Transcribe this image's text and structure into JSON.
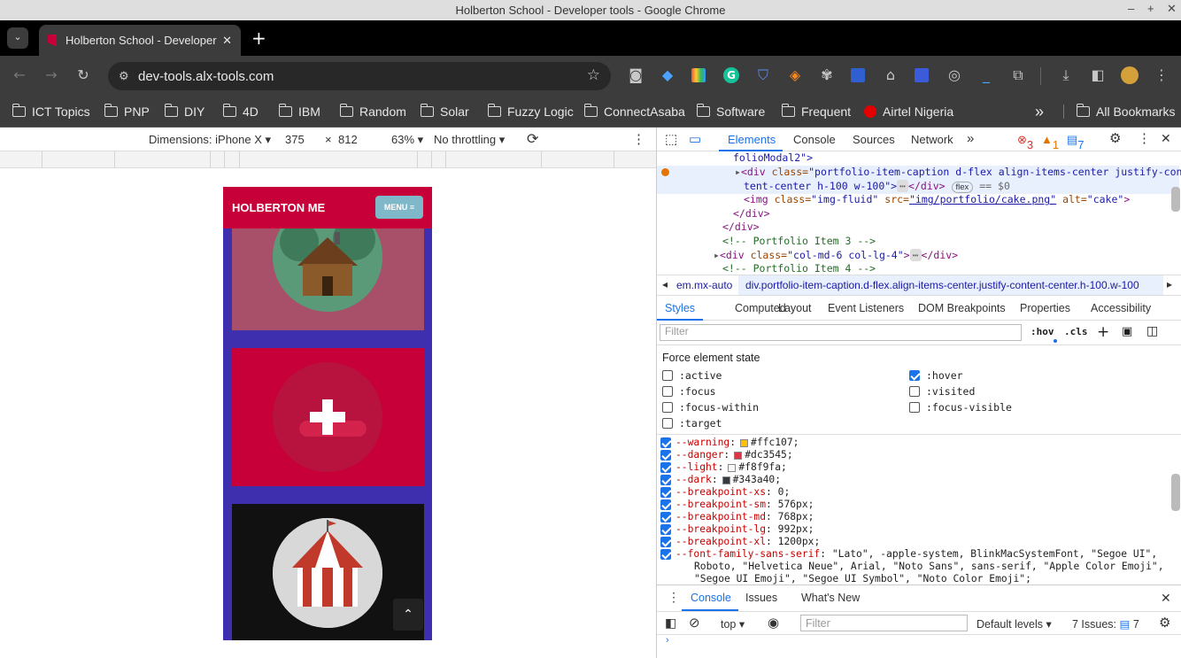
{
  "window": {
    "title": "Holberton School - Developer tools - Google Chrome",
    "min": "–",
    "max": "+",
    "close": "✕"
  },
  "tab": {
    "title": "Holberton School - Developer",
    "close": "✕",
    "new": "+"
  },
  "omnibox": {
    "url": "dev-tools.alx-tools.com"
  },
  "bookmarks": [
    "ICT Topics",
    "PNP",
    "DIY",
    "4D",
    "IBM",
    "Random",
    "Solar",
    "Fuzzy Logic",
    "ConnectAsaba",
    "Software",
    "Frequent",
    "Airtel Nigeria"
  ],
  "bookmarks_more": "»",
  "all_bookmarks": "All Bookmarks",
  "device": {
    "dimensions": "Dimensions: iPhone X ▾",
    "width": "375",
    "x": "×",
    "height": "812",
    "zoom": "63% ▾",
    "throttle": "No throttling ▾"
  },
  "site": {
    "brand": "HOLBERTON ME",
    "menu": "MENU ≡",
    "scrolltop": "⌃"
  },
  "devtools": {
    "tabs": [
      "Elements",
      "Console",
      "Sources",
      "Network"
    ],
    "more": "»",
    "errors": "3",
    "warnings": "1",
    "infos": "7",
    "dom": {
      "l1": "folioModal2\">",
      "l2_tag_open": "<div ",
      "l2_attr": "class=",
      "l2_val": "\"portfolio-item-caption d-flex align-items-center justify-con",
      "l3": "tent-center h-100 w-100\">",
      "l3_end": "</div>",
      "flex": "flex",
      "eq": "== $0",
      "l4_tag": "<img ",
      "l4_a1": "class=",
      "l4_v1": "\"img-fluid\"",
      "l4_a2": " src=",
      "l4_v2": "\"img/portfolio/cake.png\"",
      "l4_a3": " alt=",
      "l4_v3": "\"cake\"",
      "l4_end": ">",
      "l5": "</div>",
      "l6": "</div>",
      "l7": "<!-- Portfolio Item 3 -->",
      "l8_tag": "<div ",
      "l8_attr": "class=",
      "l8_val": "\"col-md-6 col-lg-4\"",
      "l8_end": "></div>",
      "l9": "<!-- Portfolio Item 4 -->"
    },
    "crumbs": [
      "em.mx-auto",
      "div.portfolio-item-caption.d-flex.align-items-center.justify-content-center.h-100.w-100"
    ],
    "subtabs": [
      "Styles",
      "Computed",
      "Layout",
      "Event Listeners",
      "DOM Breakpoints",
      "Properties",
      "Accessibility"
    ],
    "filter_placeholder": "Filter",
    "hov": ":hov",
    "cls": ".cls",
    "force_title": "Force element state",
    "states_left": [
      ":active",
      ":focus",
      ":focus-within",
      ":target"
    ],
    "states_right": [
      ":hover",
      ":visited",
      ":focus-visible"
    ],
    "vars": [
      {
        "name": "--warning",
        "value": "#ffc107;",
        "color": "#ffc107"
      },
      {
        "name": "--danger",
        "value": "#dc3545;",
        "color": "#dc3545"
      },
      {
        "name": "--light",
        "value": "#f8f9fa;",
        "color": "#f8f9fa"
      },
      {
        "name": "--dark",
        "value": "#343a40;",
        "color": "#343a40"
      },
      {
        "name": "--breakpoint-xs",
        "value": "0;"
      },
      {
        "name": "--breakpoint-sm",
        "value": "576px;"
      },
      {
        "name": "--breakpoint-md",
        "value": "768px;"
      },
      {
        "name": "--breakpoint-lg",
        "value": "992px;"
      },
      {
        "name": "--breakpoint-xl",
        "value": "1200px;"
      },
      {
        "name": "--font-family-sans-serif",
        "value": "\"Lato\", -apple-system, BlinkMacSystemFont, \"Segoe UI\","
      }
    ],
    "font_cont1": "Roboto, \"Helvetica Neue\", Arial, \"Noto Sans\", sans-serif, \"Apple Color Emoji\",",
    "font_cont2": "\"Segoe UI Emoji\", \"Segoe UI Symbol\", \"Noto Color Emoji\";",
    "drawer_tabs": [
      "Console",
      "Issues",
      "What's New"
    ],
    "console_context": "top ▾",
    "console_filter": "Filter",
    "levels": "Default levels ▾",
    "issues": "7 Issues:",
    "issues_count": "7"
  },
  "colors": {
    "site_red": "#c70039",
    "site_purple": "#3d2fad",
    "chrome_dark": "#3c3c3c",
    "accent": "#1a73e8"
  }
}
